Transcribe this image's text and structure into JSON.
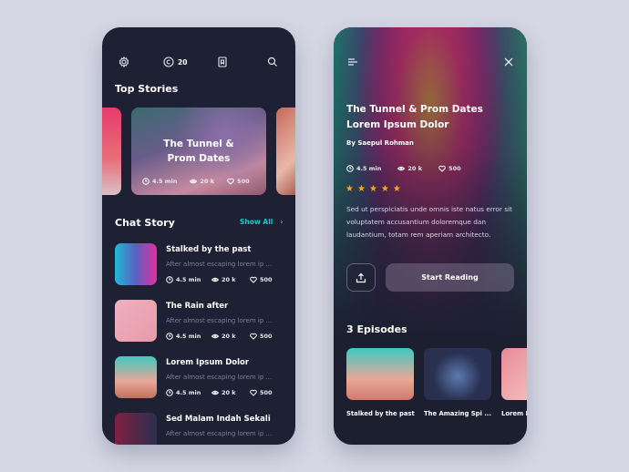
{
  "left": {
    "coins": "20",
    "top_stories_title": "Top Stories",
    "featured": {
      "title_line1": "The Tunnel &",
      "title_line2": "Prom Dates",
      "time": "4.5 min",
      "views": "20 k",
      "likes": "500"
    },
    "chat_story_title": "Chat Story",
    "show_all": "Show All",
    "items": [
      {
        "title": "Stalked by the past",
        "excerpt": "After almost escaping lorem ip ...",
        "time": "4.5 min",
        "views": "20 k",
        "likes": "500"
      },
      {
        "title": "The Rain after",
        "excerpt": "After almost escaping lorem ip ...",
        "time": "4.5 min",
        "views": "20 k",
        "likes": "500"
      },
      {
        "title": "Lorem Ipsum Dolor",
        "excerpt": "After almost escaping lorem ip ...",
        "time": "4.5 min",
        "views": "20 k",
        "likes": "500"
      },
      {
        "title": "Sed Malam Indah Sekali",
        "excerpt": "After almost escaping lorem ip ..."
      }
    ]
  },
  "right": {
    "title_line1": "The Tunnel & Prom Dates",
    "title_line2": "Lorem Ipsum Dolor",
    "author": "By Saepul Rohman",
    "time": "4.5 min",
    "views": "20 k",
    "likes": "500",
    "rating": 5,
    "description": "Sed ut perspiciatis unde omnis iste natus error sit voluptatem accusantium doloremque dan laudantium, totam rem aperiam architecto.",
    "start_reading": "Start Reading",
    "episodes_title": "3 Episodes",
    "episodes": [
      "Stalked by the past",
      "The Amazing Spi ...",
      "Lorem I"
    ]
  },
  "colors": {
    "accent": "#1fc8c8",
    "star": "#f7a81b",
    "bg": "#1e2133"
  }
}
